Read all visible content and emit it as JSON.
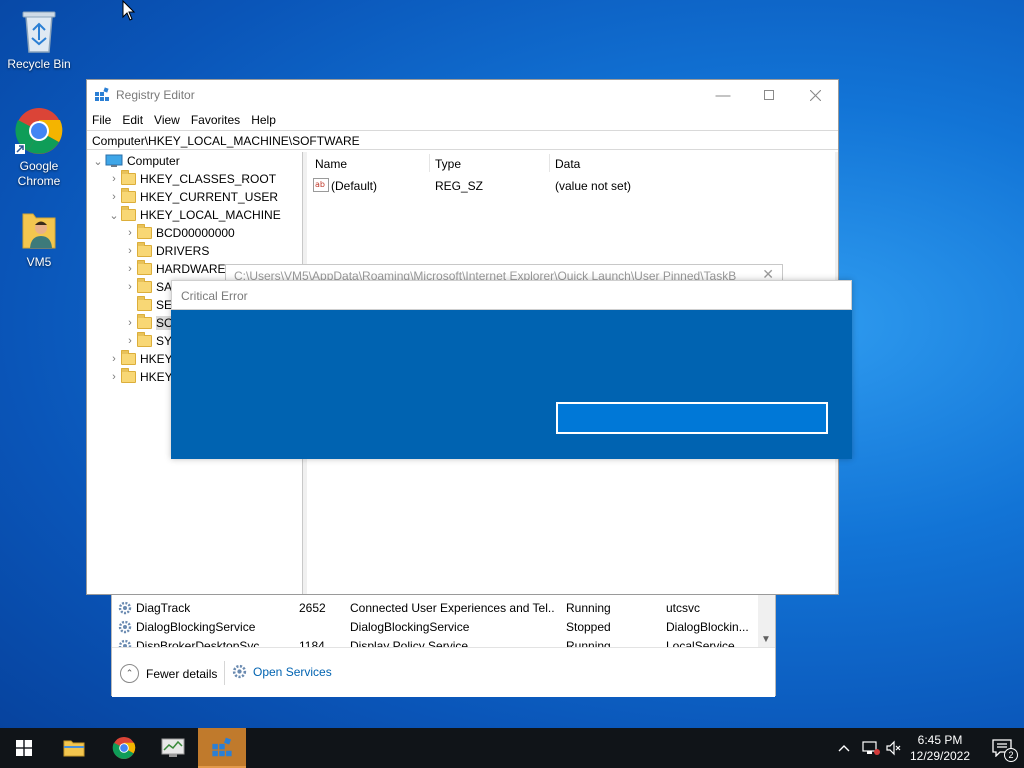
{
  "desktop": {
    "icons": [
      {
        "label": "Recycle Bin"
      },
      {
        "label": "Google\nChrome"
      },
      {
        "label": "VM5"
      }
    ]
  },
  "taskmgr": {
    "rows": [
      {
        "name": "DiagTrack",
        "pid": "2652",
        "desc": "Connected User Experiences and Tel...",
        "status": "Running",
        "group": "utcsvc"
      },
      {
        "name": "DialogBlockingService",
        "pid": "",
        "desc": "DialogBlockingService",
        "status": "Stopped",
        "group": "DialogBlockin..."
      },
      {
        "name": "DispBrokerDesktopSvc",
        "pid": "1184",
        "desc": "Display Policy Service",
        "status": "Running",
        "group": "LocalService"
      }
    ],
    "fewer_details": "Fewer details",
    "open_services": "Open Services"
  },
  "regedit": {
    "title": "Registry Editor",
    "menu": [
      "File",
      "Edit",
      "View",
      "Favorites",
      "Help"
    ],
    "address": "Computer\\HKEY_LOCAL_MACHINE\\SOFTWARE",
    "tree": [
      {
        "label": "Computer"
      },
      {
        "label": "HKEY_CLASSES_ROOT"
      },
      {
        "label": "HKEY_CURRENT_USER"
      },
      {
        "label": "HKEY_LOCAL_MACHINE"
      },
      {
        "label": "BCD00000000"
      },
      {
        "label": "DRIVERS"
      },
      {
        "label": "HARDWARE"
      },
      {
        "label": "SA"
      },
      {
        "label": "SE"
      },
      {
        "label": "SO"
      },
      {
        "label": "SY"
      },
      {
        "label": "HKEY"
      },
      {
        "label": "HKEY"
      }
    ],
    "columns": {
      "name": "Name",
      "type": "Type",
      "data": "Data"
    },
    "values": [
      {
        "name": "(Default)",
        "type": "REG_SZ",
        "data": "(value not set)"
      }
    ]
  },
  "path_window": {
    "path": "C:\\Users\\VM5\\AppData\\Roaming\\Microsoft\\Internet Explorer\\Quick Launch\\User Pinned\\TaskB"
  },
  "error_dialog": {
    "title": "Critical Error"
  },
  "taskbar": {
    "time": "6:45 PM",
    "date": "12/29/2022",
    "notifications": "2"
  },
  "colors": {
    "error_body": "#0063b1",
    "error_button": "#0078d7",
    "taskbar": "#101418",
    "active_task": "#c07a2c"
  }
}
